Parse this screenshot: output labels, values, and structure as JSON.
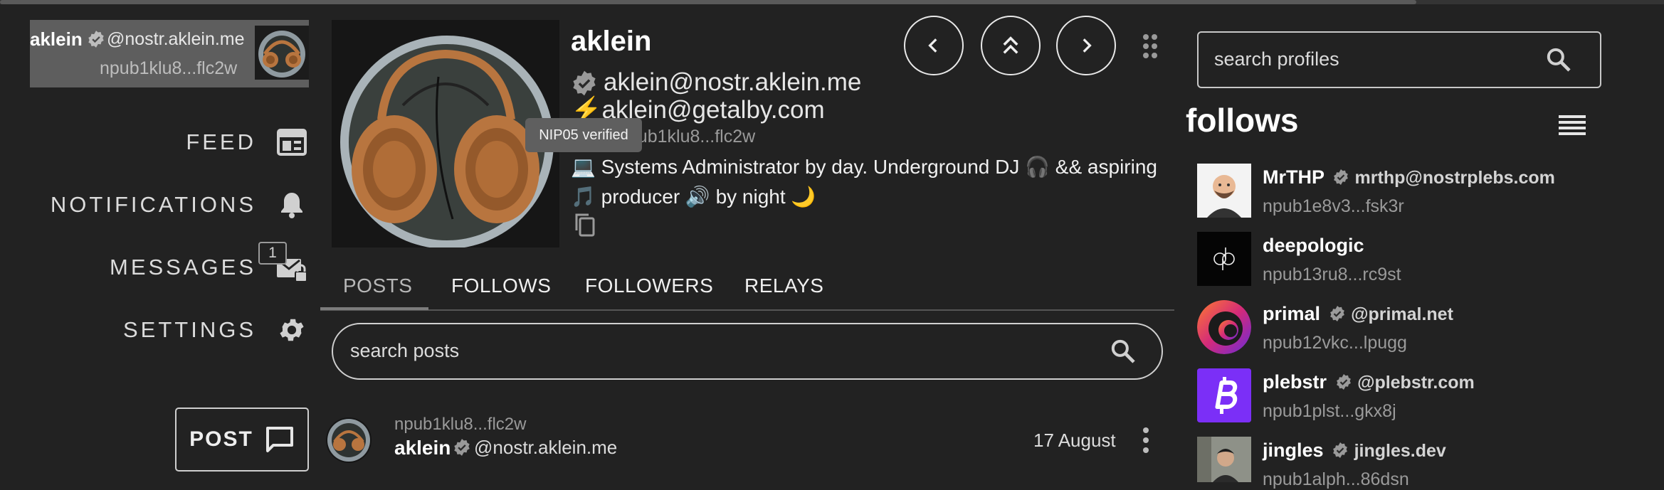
{
  "me": {
    "name": "aklein",
    "nip05": "@nostr.aklein.me",
    "npub": "npub1klu8...flc2w"
  },
  "nav": {
    "feed": "FEED",
    "notifications": "NOTIFICATIONS",
    "messages": "MESSAGES",
    "messages_badge": "1",
    "settings": "SETTINGS",
    "post_button": "POST"
  },
  "profile": {
    "name": "aklein",
    "nip05": "aklein@nostr.aklein.me",
    "lightning": "⚡aklein@getalby.com",
    "npub": "npub1klu8...flc2w",
    "tooltip": "NIP05 verified",
    "bio": "💻 Systems Administrator by day. Underground DJ 🎧 && aspiring 🎵 producer 🔊 by night 🌙"
  },
  "tabs": [
    "POSTS",
    "FOLLOWS",
    "FOLLOWERS",
    "RELAYS"
  ],
  "search_posts": {
    "placeholder": "search posts"
  },
  "post": {
    "npub": "npub1klu8...flc2w",
    "author": "aklein",
    "nip05": "@nostr.aklein.me",
    "date": "17 August"
  },
  "search_profiles": {
    "placeholder": "search profiles"
  },
  "follows": {
    "title": "follows",
    "items": [
      {
        "name": "MrTHP",
        "nip05": "mrthp@nostrplebs.com",
        "npub": "npub1e8v3...fsk3r"
      },
      {
        "name": "deepologic",
        "nip05": "",
        "npub": "npub13ru8...rc9st"
      },
      {
        "name": "primal",
        "nip05": "@primal.net",
        "npub": "npub12vkc...lpugg"
      },
      {
        "name": "plebstr",
        "nip05": "@plebstr.com",
        "npub": "npub1plst...gkx8j"
      },
      {
        "name": "jingles",
        "nip05": "jingles.dev",
        "npub": "npub1alph...86dsn"
      }
    ]
  },
  "colors": {
    "background": "#222222",
    "plebstr_brand": "#7b2ff7",
    "headphone_copper": "#b8753f"
  }
}
